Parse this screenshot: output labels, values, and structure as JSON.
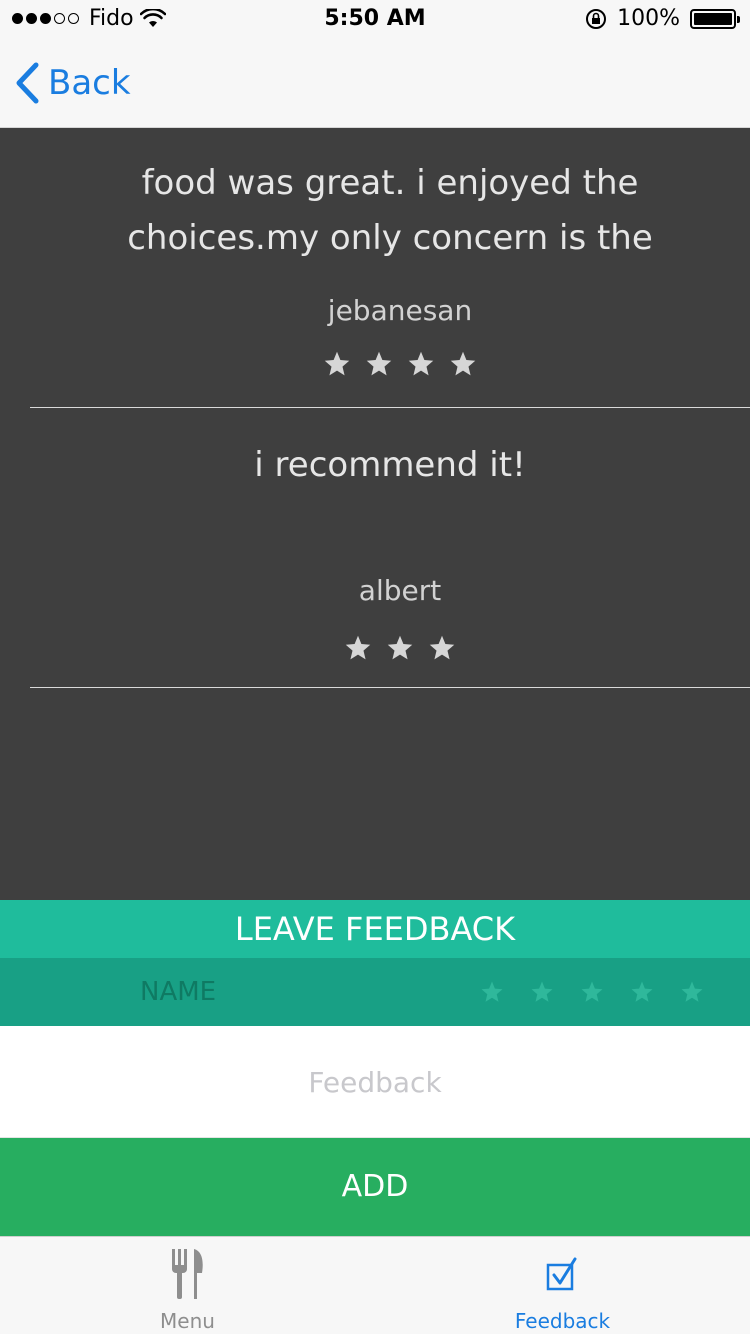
{
  "status_bar": {
    "carrier": "Fido",
    "time": "5:50 AM",
    "battery": "100%"
  },
  "nav": {
    "back_label": "Back"
  },
  "reviews": [
    {
      "text": "food was great. i enjoyed the choices.my only concern is the",
      "author": "jebanesan",
      "rating": 4
    },
    {
      "text": "i recommend it!",
      "author": "albert",
      "rating": 3
    }
  ],
  "form": {
    "header": "LEAVE FEEDBACK",
    "name_placeholder": "NAME",
    "feedback_placeholder": "Feedback",
    "add_label": "ADD",
    "star_count": 5
  },
  "tabs": [
    {
      "label": "Menu",
      "icon": "fork-knife-icon",
      "active": false
    },
    {
      "label": "Feedback",
      "icon": "checkbox-icon",
      "active": true
    }
  ],
  "colors": {
    "accent": "#1a7de0",
    "teal": "#1fbc9c",
    "teal_dark": "#18a085",
    "green": "#27ae60",
    "background": "#3f3f3f"
  }
}
